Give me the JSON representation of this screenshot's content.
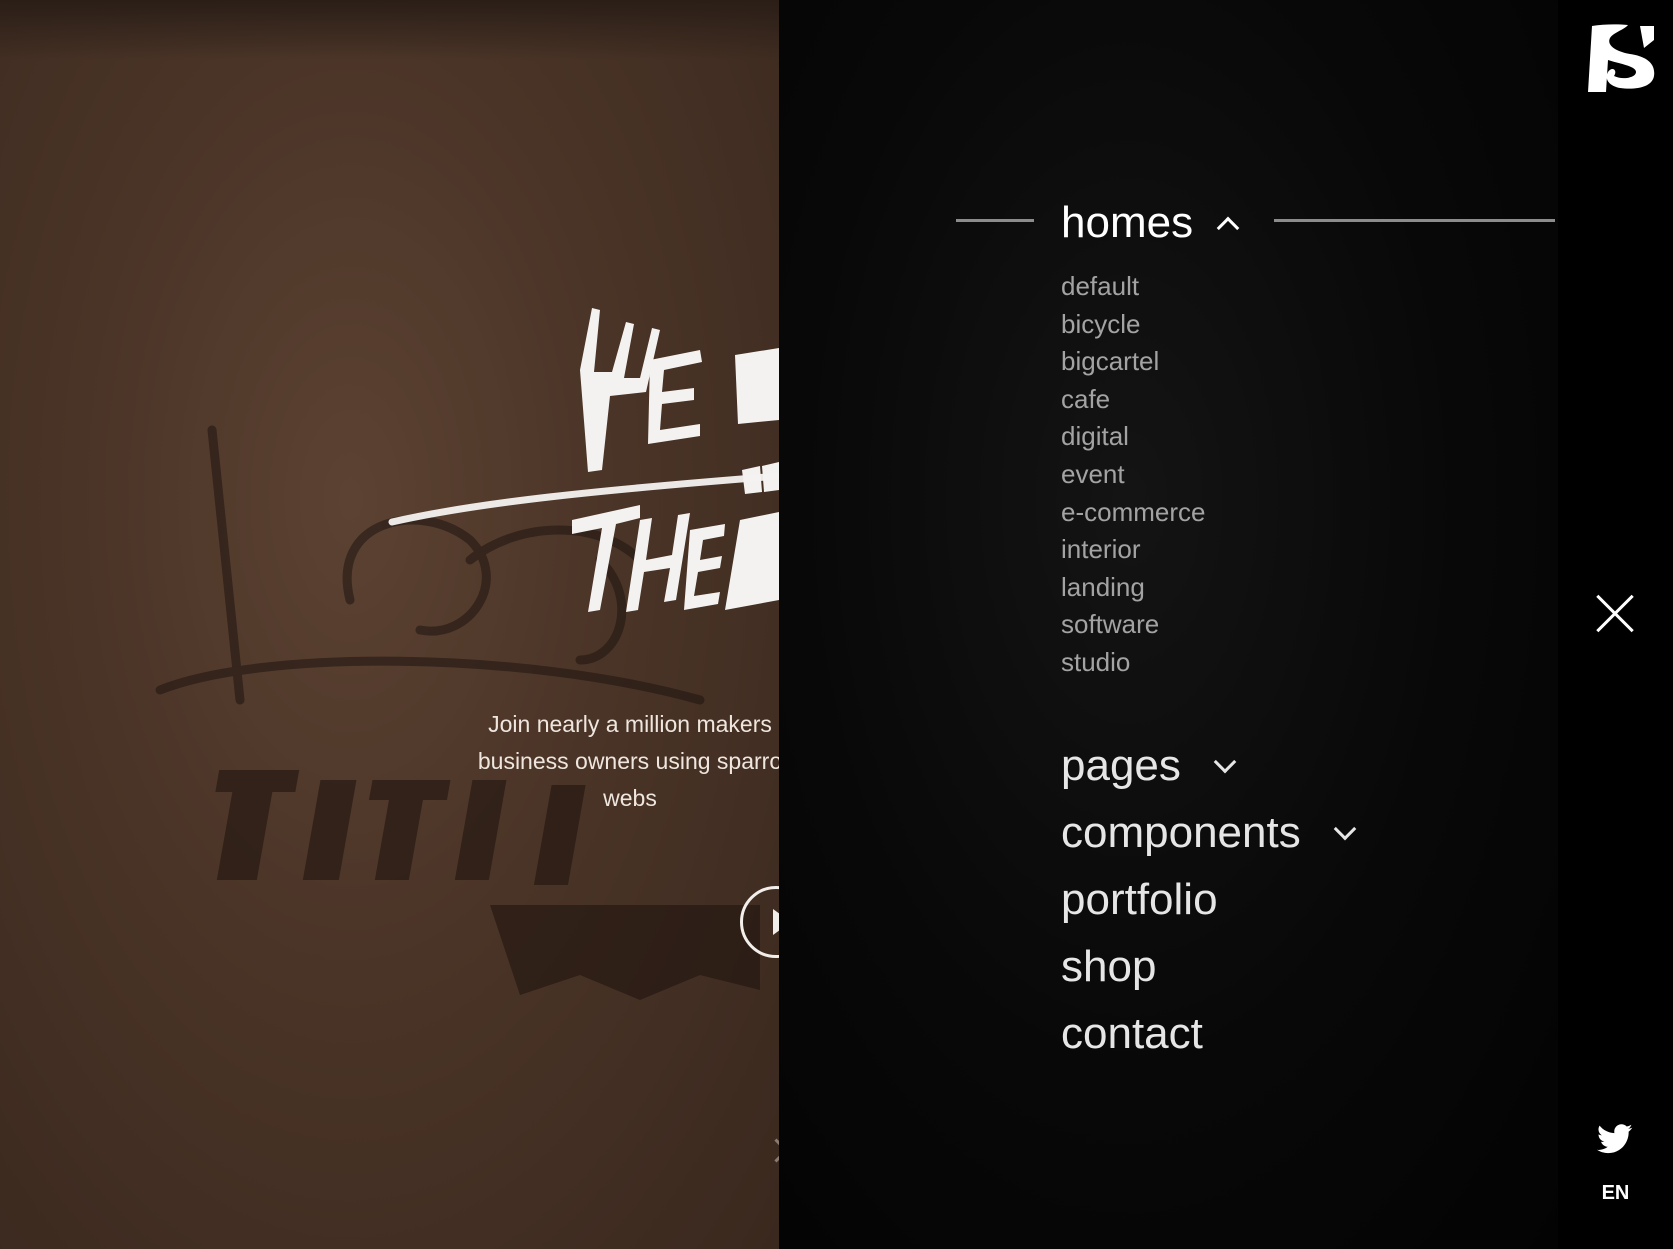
{
  "hero": {
    "headline_logo": "We ... in The ...",
    "subtitle": "Join nearly a million makers\nbusiness owners using sparro\nwebs",
    "play_button": "play-icon"
  },
  "menu": {
    "homes": {
      "label": "homes",
      "expanded": true,
      "items": [
        "default",
        "bicycle",
        "bigcartel",
        "cafe",
        "digital",
        "event",
        "e-commerce",
        "interior",
        "landing",
        "software",
        "studio"
      ]
    },
    "main_items": [
      {
        "label": "pages",
        "has_dropdown": true
      },
      {
        "label": "components",
        "has_dropdown": true
      },
      {
        "label": "portfolio",
        "has_dropdown": false
      },
      {
        "label": "shop",
        "has_dropdown": false
      },
      {
        "label": "contact",
        "has_dropdown": false
      }
    ]
  },
  "sidebar": {
    "logo": "S",
    "close_icon": "close-icon",
    "social_icon": "twitter-icon",
    "language": "EN"
  },
  "colors": {
    "hero_background": "#4a3427",
    "menu_background": "#080808",
    "menu_text": "#e6e6e6",
    "submenu_text": "#a3a3a3"
  }
}
